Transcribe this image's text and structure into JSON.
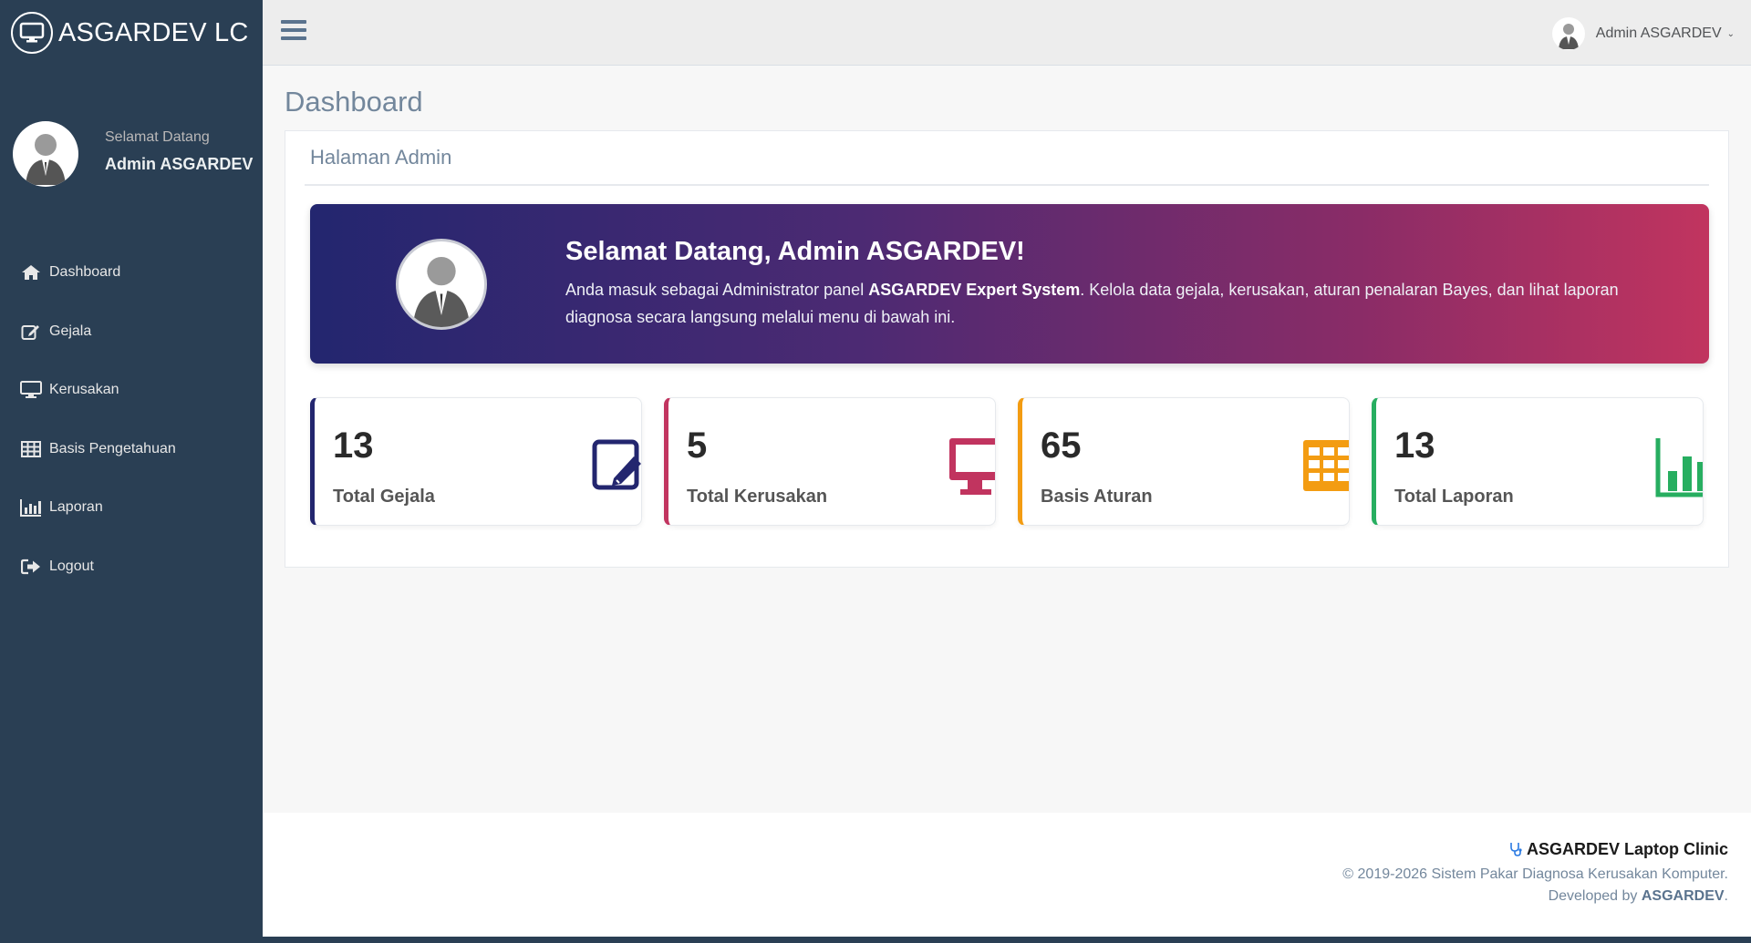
{
  "brand": {
    "title": "ASGARDEV LC",
    "icon": "monitor-icon"
  },
  "profile": {
    "welcome": "Selamat Datang",
    "name": "Admin ASGARDEV"
  },
  "sidebar": {
    "items": [
      {
        "label": "Dashboard",
        "icon": "home-icon"
      },
      {
        "label": "Gejala",
        "icon": "edit-icon"
      },
      {
        "label": "Kerusakan",
        "icon": "monitor-icon"
      },
      {
        "label": "Basis Pengetahuan",
        "icon": "table-icon"
      },
      {
        "label": "Laporan",
        "icon": "bar-chart-icon"
      },
      {
        "label": "Logout",
        "icon": "sign-out-icon"
      }
    ]
  },
  "topnav": {
    "user_name": "Admin ASGARDEV"
  },
  "page": {
    "title": "Dashboard",
    "panel_title": "Halaman Admin"
  },
  "hero": {
    "title": "Selamat Datang, Admin ASGARDEV!",
    "desc_pre": "Anda masuk sebagai Administrator panel ",
    "desc_bold": "ASGARDEV Expert System",
    "desc_post": ". Kelola data gejala, kerusakan, aturan penalaran Bayes, dan lihat laporan diagnosa secara langsung melalui menu di bawah ini."
  },
  "stats": [
    {
      "value": "13",
      "label": "Total Gejala",
      "color": "#23266f",
      "icon": "edit-icon"
    },
    {
      "value": "5",
      "label": "Total Kerusakan",
      "color": "#c1345f",
      "icon": "monitor-icon"
    },
    {
      "value": "65",
      "label": "Basis Aturan",
      "color": "#f39c12",
      "icon": "table-icon"
    },
    {
      "value": "13",
      "label": "Total Laporan",
      "color": "#27ae60",
      "icon": "bar-chart-icon"
    }
  ],
  "footer": {
    "brand": "ASGARDEV Laptop Clinic",
    "copyright": "© 2019-2026 Sistem Pakar Diagnosa Kerusakan Komputer.",
    "dev_pre": "Developed by ",
    "dev_name": "ASGARDEV",
    "dev_post": "."
  },
  "colors": {
    "sidebar": "#2a3f54",
    "accent": "#5a738e"
  }
}
